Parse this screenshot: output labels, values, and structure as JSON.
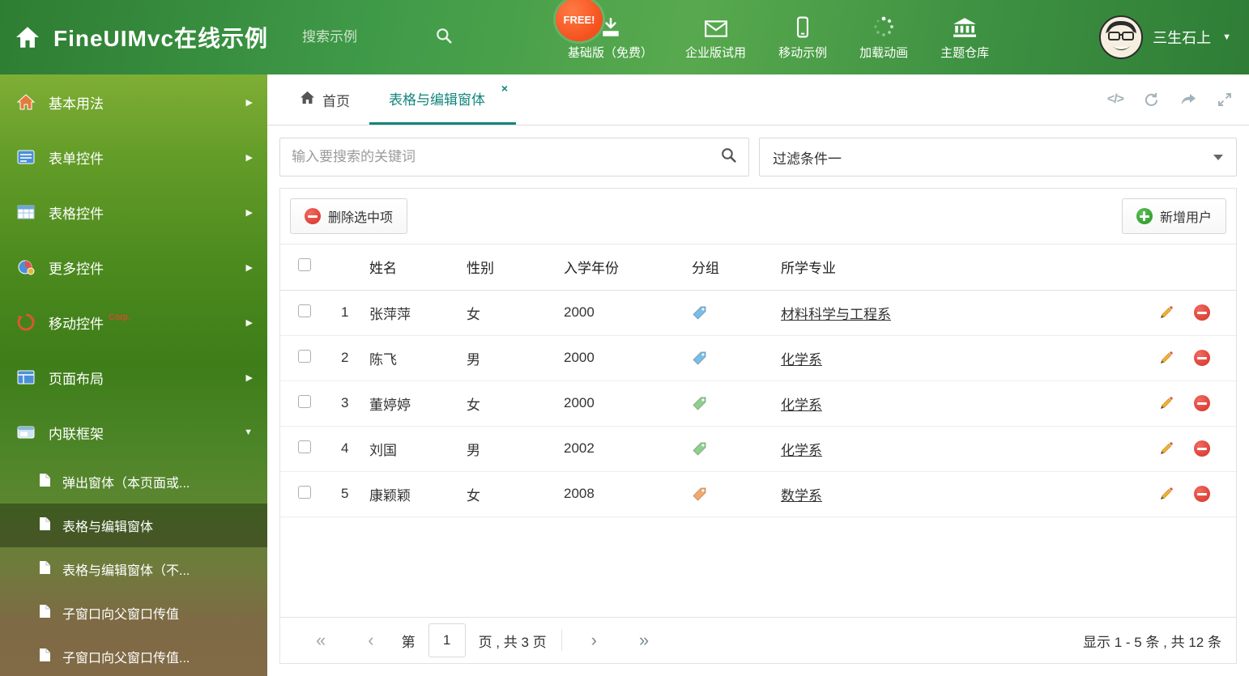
{
  "colors": {
    "accent_teal": "#11867d",
    "header_green": "#3f9a48",
    "free_badge_orange": "#f4511e"
  },
  "header": {
    "title": "FineUIMvc在线示例",
    "search_placeholder": "搜索示例",
    "free_badge": "FREE!",
    "nav": [
      {
        "label": "基础版（免费）",
        "icon": "download-icon"
      },
      {
        "label": "企业版试用",
        "icon": "envelope-icon"
      },
      {
        "label": "移动示例",
        "icon": "mobile-icon"
      },
      {
        "label": "加载动画",
        "icon": "spinner-icon"
      },
      {
        "label": "主题仓库",
        "icon": "bank-icon"
      }
    ],
    "user_name": "三生石上"
  },
  "sidebar": {
    "items": [
      {
        "label": "基本用法"
      },
      {
        "label": "表单控件"
      },
      {
        "label": "表格控件"
      },
      {
        "label": "更多控件"
      },
      {
        "label": "移动控件",
        "badge": "Corp."
      },
      {
        "label": "页面布局"
      },
      {
        "label": "内联框架"
      }
    ],
    "subitems": [
      {
        "label": "弹出窗体（本页面或..."
      },
      {
        "label": "表格与编辑窗体"
      },
      {
        "label": "表格与编辑窗体（不..."
      },
      {
        "label": "子窗口向父窗口传值"
      },
      {
        "label": "子窗口向父窗口传值..."
      }
    ]
  },
  "tabs": {
    "home": "首页",
    "active": "表格与编辑窗体",
    "close": "×"
  },
  "toolbar_icons": {
    "code": "</>"
  },
  "filters": {
    "keyword_placeholder": "输入要搜索的关键词",
    "filter_value": "过滤条件一"
  },
  "actions": {
    "delete_selected": "删除选中项",
    "add_user": "新增用户"
  },
  "table": {
    "headers": {
      "name": "姓名",
      "gender": "性别",
      "year": "入学年份",
      "group": "分组",
      "major": "所学专业"
    },
    "rows": [
      {
        "num": "1",
        "name": "张萍萍",
        "gender": "女",
        "year": "2000",
        "tag_color": "#79bde9",
        "major": "材料科学与工程系"
      },
      {
        "num": "2",
        "name": "陈飞",
        "gender": "男",
        "year": "2000",
        "tag_color": "#79bde9",
        "major": "化学系"
      },
      {
        "num": "3",
        "name": "董婷婷",
        "gender": "女",
        "year": "2000",
        "tag_color": "#8ed08e",
        "major": "化学系"
      },
      {
        "num": "4",
        "name": "刘国",
        "gender": "男",
        "year": "2002",
        "tag_color": "#8ed08e",
        "major": "化学系"
      },
      {
        "num": "5",
        "name": "康颖颖",
        "gender": "女",
        "year": "2008",
        "tag_color": "#f2a96a",
        "major": "数学系"
      }
    ]
  },
  "pagination": {
    "prefix": "第",
    "page_value": "1",
    "suffix": "页 , 共 3 页",
    "summary": "显示 1 - 5 条 , 共 12 条"
  }
}
